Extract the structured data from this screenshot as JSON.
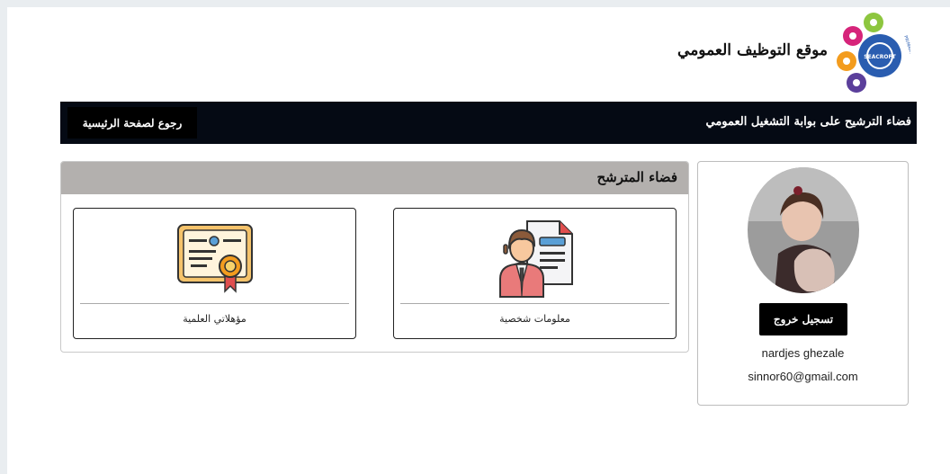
{
  "header": {
    "site_title": "موقع التوظيف العمومي",
    "logo_text": "SEACROFT",
    "logo_ring_text": "PRIMARY CARE NETWORK"
  },
  "navbar": {
    "title": "فضاء الترشيح على بوابة التشغيل العمومي",
    "home_label": "رجوع لصفحة الرئيسية"
  },
  "profile": {
    "logout_label": "تسجيل خروج",
    "name": "nardjes ghezale",
    "email": "sinnor60@gmail.com"
  },
  "panel": {
    "title": "فضاء المترشح",
    "tiles": [
      {
        "label": "معلومات شخصية",
        "icon": "personal-info-icon"
      },
      {
        "label": "مؤهلاتي العلمية",
        "icon": "certificate-icon"
      }
    ]
  },
  "colors": {
    "navbar_bg": "#050a14",
    "panel_header_bg": "#b3b0ae",
    "button_bg": "#000000"
  }
}
